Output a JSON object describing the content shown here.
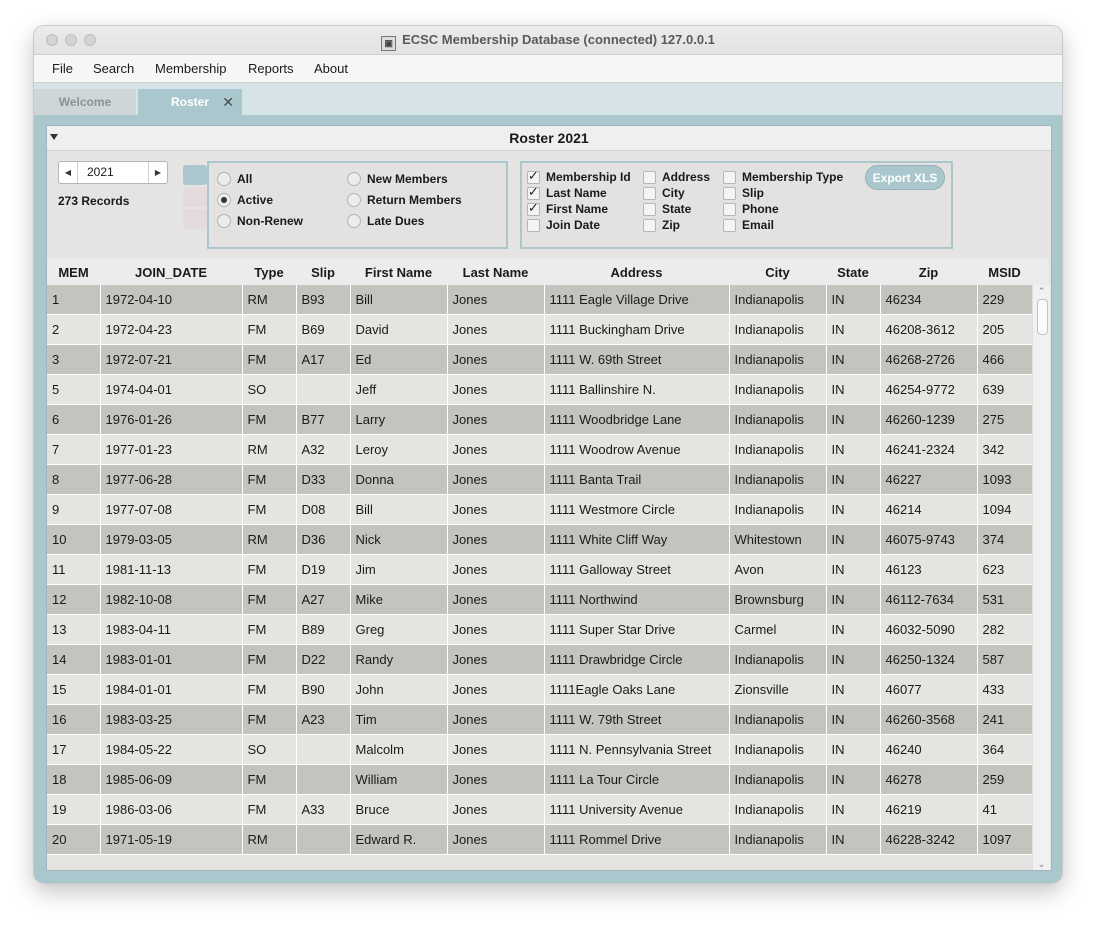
{
  "window": {
    "title": "ECSC Membership Database (connected) 127.0.0.1"
  },
  "menu": [
    "File",
    "Search",
    "Membership",
    "Reports",
    "About"
  ],
  "tabs": {
    "welcome": "Welcome",
    "roster": "Roster",
    "close_glyph": "✕"
  },
  "panel": {
    "title": "Roster 2021"
  },
  "year_spinner": {
    "value": "2021",
    "left_glyph": "◀",
    "right_glyph": "▶"
  },
  "record_count": "273 Records",
  "filters": [
    {
      "label": "All",
      "selected": false
    },
    {
      "label": "New Members",
      "selected": false
    },
    {
      "label": "Active",
      "selected": true
    },
    {
      "label": "Return Members",
      "selected": false
    },
    {
      "label": "Non-Renew",
      "selected": false
    },
    {
      "label": "Late Dues",
      "selected": false
    }
  ],
  "fields": [
    {
      "label": "Membership Id",
      "checked": true
    },
    {
      "label": "Last Name",
      "checked": true
    },
    {
      "label": "First Name",
      "checked": true
    },
    {
      "label": "Join Date",
      "checked": false
    },
    {
      "label": "Address",
      "checked": false
    },
    {
      "label": "City",
      "checked": false
    },
    {
      "label": "State",
      "checked": false
    },
    {
      "label": "Zip",
      "checked": false
    },
    {
      "label": "Membership Type",
      "checked": false
    },
    {
      "label": "Slip",
      "checked": false
    },
    {
      "label": "Phone",
      "checked": false
    },
    {
      "label": "Email",
      "checked": false
    }
  ],
  "export_button": "Export XLS",
  "colors": {
    "accent": "#a9c7cd",
    "row_dark": "#c4c4be",
    "row_light": "#e5e4e0",
    "row_selected": "#a4c7cf"
  },
  "table": {
    "columns": [
      "MEM",
      "JOIN_DATE",
      "Type",
      "Slip",
      "First Name",
      "Last Name",
      "Address",
      "City",
      "State",
      "Zip",
      "MSID"
    ],
    "selected_row": 19,
    "rows": [
      [
        "1",
        "1972-04-10",
        "RM",
        "B93",
        "Bill",
        "Jones",
        "1111 Eagle Village Drive",
        "Indianapolis",
        "IN",
        "46234",
        "229"
      ],
      [
        "2",
        "1972-04-23",
        "FM",
        "B69",
        "David",
        "Jones",
        "1111 Buckingham Drive",
        "Indianapolis",
        "IN",
        "46208-3612",
        "205"
      ],
      [
        "3",
        "1972-07-21",
        "FM",
        "A17",
        "Ed",
        "Jones",
        "1111 W. 69th Street",
        "Indianapolis",
        "IN",
        "46268-2726",
        "466"
      ],
      [
        "5",
        "1974-04-01",
        "SO",
        "",
        "Jeff",
        "Jones",
        "1111 Ballinshire N.",
        "Indianapolis",
        "IN",
        "46254-9772",
        "639"
      ],
      [
        "6",
        "1976-01-26",
        "FM",
        "B77",
        "Larry",
        "Jones",
        "1111 Woodbridge Lane",
        "Indianapolis",
        "IN",
        "46260-1239",
        "275"
      ],
      [
        "7",
        "1977-01-23",
        "RM",
        "A32",
        "Leroy",
        "Jones",
        "1111 Woodrow Avenue",
        "Indianapolis",
        "IN",
        "46241-2324",
        "342"
      ],
      [
        "8",
        "1977-06-28",
        "FM",
        "D33",
        "Donna",
        "Jones",
        "1111 Banta Trail",
        "Indianapolis",
        "IN",
        "46227",
        "1093"
      ],
      [
        "9",
        "1977-07-08",
        "FM",
        "D08",
        "Bill",
        "Jones",
        "1111 Westmore Circle",
        "Indianapolis",
        "IN",
        "46214",
        "1094"
      ],
      [
        "10",
        "1979-03-05",
        "RM",
        "D36",
        "Nick",
        "Jones",
        "1111 White Cliff Way",
        "Whitestown",
        "IN",
        "46075-9743",
        "374"
      ],
      [
        "11",
        "1981-11-13",
        "FM",
        "D19",
        "Jim",
        "Jones",
        "1111 Galloway Street",
        "Avon",
        "IN",
        "46123",
        "623"
      ],
      [
        "12",
        "1982-10-08",
        "FM",
        "A27",
        "Mike",
        "Jones",
        "1111 Northwind",
        "Brownsburg",
        "IN",
        "46112-7634",
        "531"
      ],
      [
        "13",
        "1983-04-11",
        "FM",
        "B89",
        "Greg",
        "Jones",
        "1111 Super Star Drive",
        "Carmel",
        "IN",
        "46032-5090",
        "282"
      ],
      [
        "14",
        "1983-01-01",
        "FM",
        "D22",
        "Randy",
        "Jones",
        "1111 Drawbridge Circle",
        "Indianapolis",
        "IN",
        "46250-1324",
        "587"
      ],
      [
        "15",
        "1984-01-01",
        "FM",
        "B90",
        "John",
        "Jones",
        "1111Eagle Oaks Lane",
        "Zionsville",
        "IN",
        "46077",
        "433"
      ],
      [
        "16",
        "1983-03-25",
        "FM",
        "A23",
        "Tim",
        "Jones",
        "1111 W. 79th Street",
        "Indianapolis",
        "IN",
        "46260-3568",
        "241"
      ],
      [
        "17",
        "1984-05-22",
        "SO",
        "",
        "Malcolm",
        "Jones",
        "1111 N. Pennsylvania Street",
        "Indianapolis",
        "IN",
        "46240",
        "364"
      ],
      [
        "18",
        "1985-06-09",
        "FM",
        "",
        "William",
        "Jones",
        "1111 La Tour Circle",
        "Indianapolis",
        "IN",
        "46278",
        "259"
      ],
      [
        "19",
        "1986-03-06",
        "FM",
        "A33",
        "Bruce",
        "Jones",
        "1111 University Avenue",
        "Indianapolis",
        "IN",
        "46219",
        "41"
      ],
      [
        "20",
        "1971-05-19",
        "RM",
        "",
        "Edward R.",
        "Jones",
        "1111 Rommel Drive",
        "Indianapolis",
        "IN",
        "46228-3242",
        "1097"
      ]
    ]
  },
  "scrollbar": {
    "up_glyph": "⌃",
    "down_glyph": "⌄"
  }
}
